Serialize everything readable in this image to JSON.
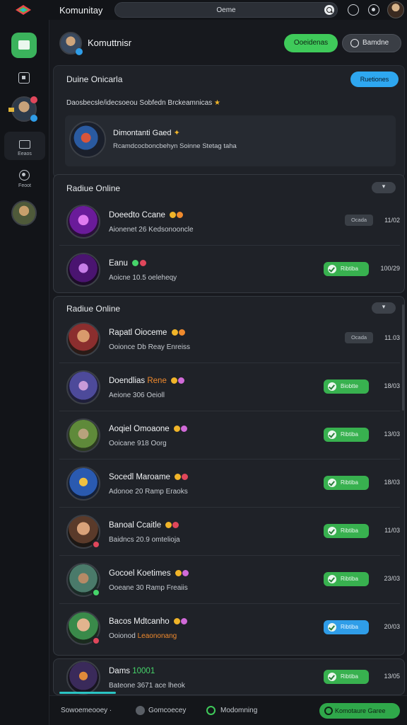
{
  "topbar": {
    "title": "Komunitay",
    "search": {
      "value": "Oeme"
    }
  },
  "sidebar": {
    "items": [
      {
        "label": "Eeaos"
      },
      {
        "label": "Feoot"
      }
    ]
  },
  "header": {
    "title": "Komuttnisr",
    "primary_button": "Ooeidenas",
    "secondary_button": "Bamdne"
  },
  "card_featured": {
    "title": "Duine Onicarla",
    "pill": "Ruetiones",
    "description": "Daosbecsle/idecsoeou Sobfedn Brckeamnicas",
    "item": {
      "title": "Dimontanti Gaed",
      "subtitle": "Rcamdcocboncbehyn Soinne Stetag taha"
    }
  },
  "card_online_1": {
    "title": "Radiue Online",
    "rows": [
      {
        "name": "Doeedto Ccane",
        "sub": "Aionenet 26 Kedsonooncle",
        "status": "Ocada",
        "status_type": "grey",
        "num": "11/02"
      },
      {
        "name": "Eanu",
        "sub": "Aoicne 10.5 oeleheqy",
        "status": "Ribtiba",
        "status_type": "green",
        "num": "100/29"
      }
    ]
  },
  "card_online_2": {
    "title": "Radiue Online",
    "rows": [
      {
        "name": "Rapatl Oioceme",
        "name_accent": "",
        "sub": "Ooionce Db Reay Enreiss",
        "status": "Ocada",
        "status_type": "grey",
        "num": "11.03"
      },
      {
        "name": "Doendlias",
        "name_accent": "Rene",
        "sub": "Aeione 306 Oeioll",
        "status": "Biobtte",
        "status_type": "green",
        "num": "18/03"
      },
      {
        "name": "Aoqiel Omoaone",
        "name_accent": "",
        "sub": "Ooicane 918 Oorg",
        "status": "Ribtiba",
        "status_type": "green",
        "num": "13/03"
      },
      {
        "name": "Socedl Maroame",
        "name_accent": "",
        "sub": "Adonoe 20 Ramp Eraoks",
        "status": "Ribtiba",
        "status_type": "green",
        "num": "18/03"
      },
      {
        "name": "Banoal Ccaitle",
        "name_accent": "",
        "sub": "Baidncs 20.9 omtelioja",
        "status": "Ribtiba",
        "status_type": "green",
        "num": "11/03"
      },
      {
        "name": "Gocoel Koetimes",
        "name_accent": "",
        "sub": "Ooeane 30 Ramp Freaiis",
        "status": "Ribtiba",
        "status_type": "green",
        "num": "23/03"
      },
      {
        "name": "Bacos Mdtcanho",
        "name_accent": "",
        "sub": "Ooionod",
        "sub_accent": "Leaononang",
        "status": "Ribtiba",
        "status_type": "blue",
        "num": "20/03"
      }
    ]
  },
  "card_bottom": {
    "row": {
      "name": "Dams",
      "name_green": "10001",
      "sub": "Bateone 3671 ace lheok",
      "status": "Ribtiba",
      "status_type": "green",
      "num": "13/05"
    }
  },
  "bottombar": {
    "items": [
      {
        "label": "Sowoemeooey ·"
      },
      {
        "label": "Gomcoecey"
      },
      {
        "label": "Modomning"
      }
    ],
    "action": "Komotaure Garee"
  },
  "colors": {
    "accent_green": "#3fca5a",
    "accent_blue": "#2ea7f0",
    "highlight_orange": "#f08a2d",
    "background": "#17191e"
  }
}
